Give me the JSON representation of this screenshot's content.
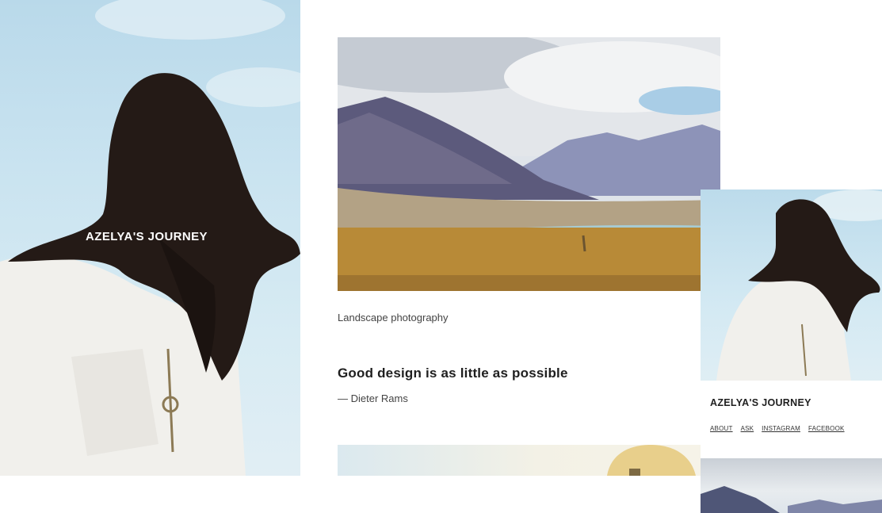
{
  "site": {
    "title": "AZELYA'S JOURNEY"
  },
  "hero": {
    "image": "woman-windswept-hair-sky-photo"
  },
  "post": {
    "image": "mountain-lake-landscape-photo",
    "caption": "Landscape photography"
  },
  "quote": {
    "text": "Good design is as little as possible",
    "author": "— Dieter Rams"
  },
  "next_post": {
    "image": "desert-dome-building-photo"
  },
  "mobile": {
    "title": "AZELYA'S JOURNEY",
    "nav": [
      "ABOUT",
      "ASK",
      "INSTAGRAM",
      "FACEBOOK"
    ]
  },
  "colors": {
    "background": "#ffffff",
    "text": "#1f1f1f",
    "sky": "#c9e3f0"
  }
}
